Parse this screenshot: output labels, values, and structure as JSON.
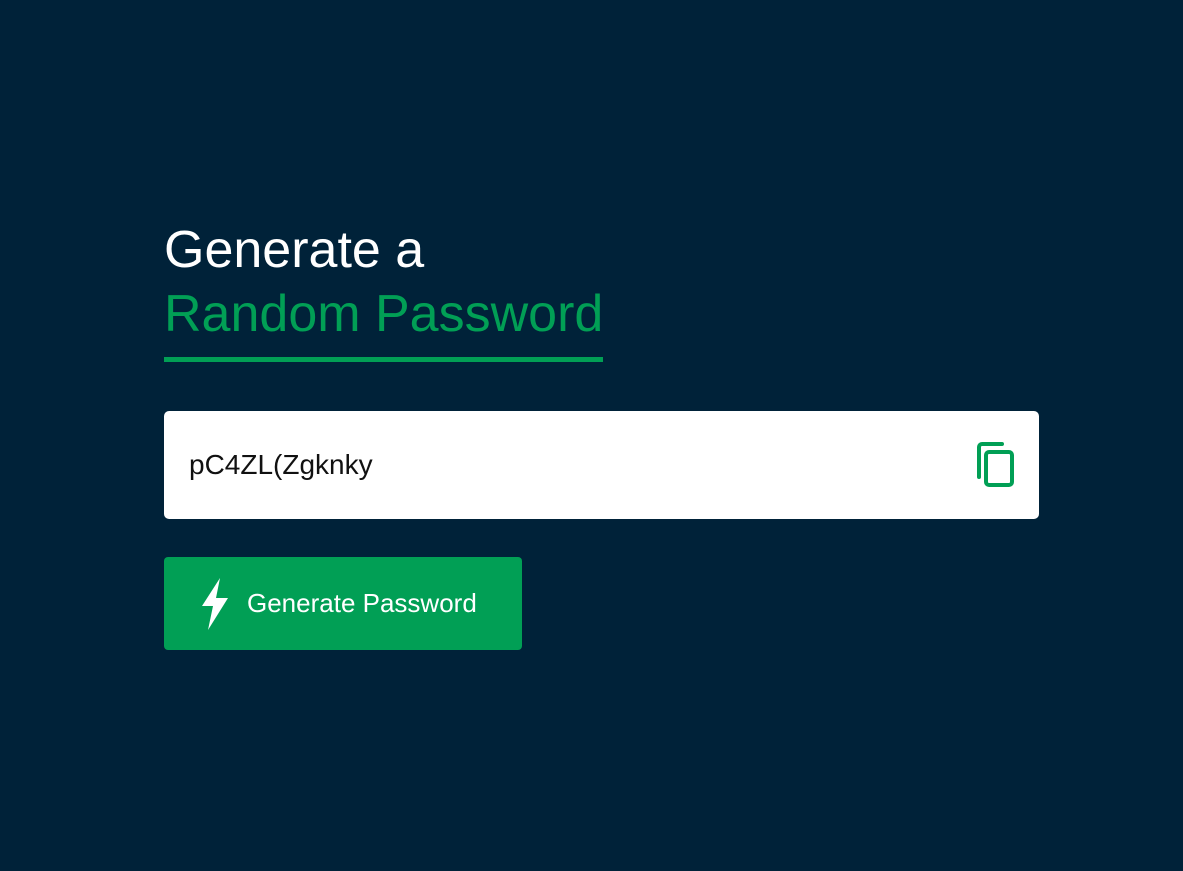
{
  "heading": {
    "line1": "Generate a",
    "line2": "Random Password"
  },
  "password": {
    "value": "pC4ZL(Zgknky"
  },
  "copy_button": {
    "icon": "copy-icon"
  },
  "generate_button": {
    "label": "Generate Password",
    "icon": "lightning-bolt-icon"
  },
  "colors": {
    "background": "#002239",
    "accent": "#019f55",
    "text_light": "#ffffff",
    "field_background": "#ffffff"
  }
}
